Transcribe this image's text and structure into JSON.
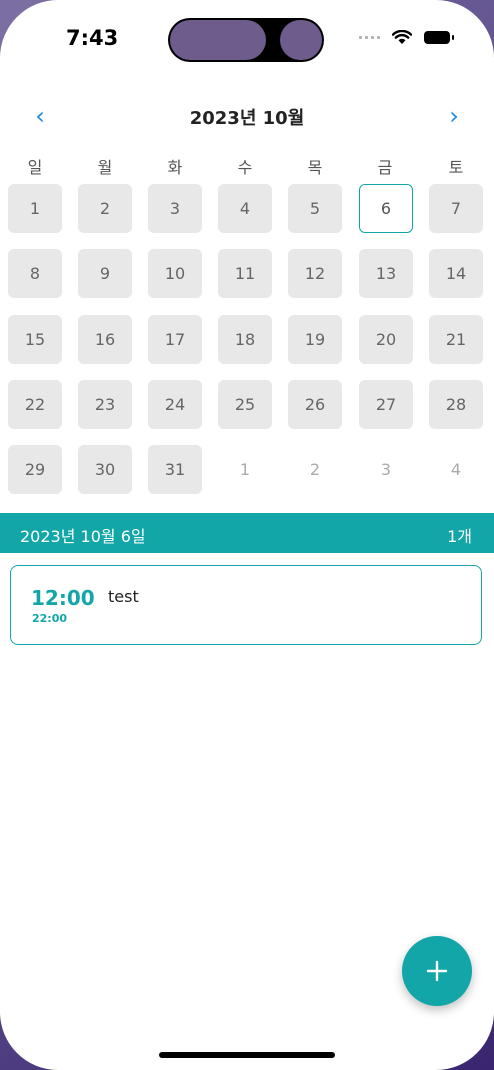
{
  "status_bar": {
    "time": "7:43"
  },
  "calendar": {
    "prev_icon": "‹",
    "next_icon": "›",
    "month_title": "2023년 10월",
    "weekdays": [
      "일",
      "월",
      "화",
      "수",
      "목",
      "금",
      "토"
    ],
    "days": [
      [
        "1",
        "2",
        "3",
        "4",
        "5",
        "6",
        "7"
      ],
      [
        "8",
        "9",
        "10",
        "11",
        "12",
        "13",
        "14"
      ],
      [
        "15",
        "16",
        "17",
        "18",
        "19",
        "20",
        "21"
      ],
      [
        "22",
        "23",
        "24",
        "25",
        "26",
        "27",
        "28"
      ],
      [
        "29",
        "30",
        "31",
        "1",
        "2",
        "3",
        "4"
      ]
    ],
    "selected_day": "6"
  },
  "selected_date": {
    "label": "2023년 10월 6일",
    "count": "1개"
  },
  "events": [
    {
      "start": "12:00",
      "end": "22:00",
      "title": "test"
    }
  ],
  "colors": {
    "accent": "#12a6a8",
    "nav": "#1e8ae0",
    "cell_bg": "#e8e8e8"
  },
  "fab": {
    "icon": "plus-icon"
  }
}
